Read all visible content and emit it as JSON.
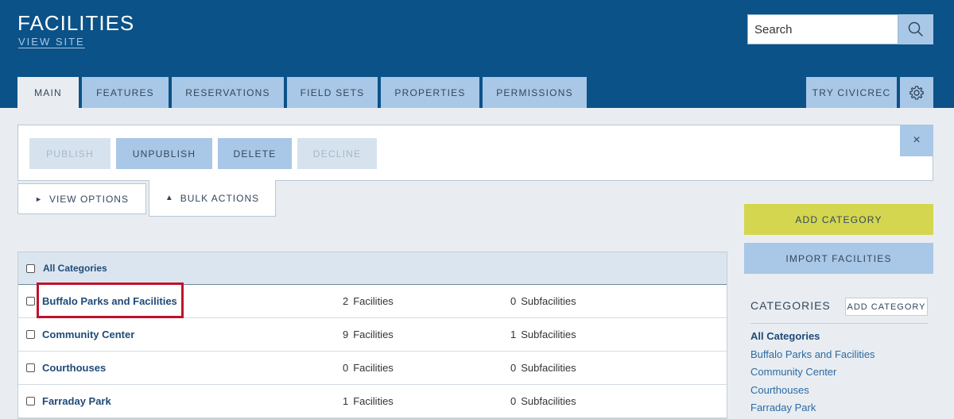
{
  "header": {
    "title": "FACILITIES",
    "view_site": "VIEW SITE",
    "search_placeholder": "Search",
    "tabs": [
      "MAIN",
      "FEATURES",
      "RESERVATIONS",
      "FIELD SETS",
      "PROPERTIES",
      "PERMISSIONS"
    ],
    "try_civicrec": "TRY CIVICREC"
  },
  "actions": {
    "publish": "PUBLISH",
    "unpublish": "UNPUBLISH",
    "delete": "DELETE",
    "decline": "DECLINE",
    "close": "×",
    "view_options": "VIEW OPTIONS",
    "bulk_actions": "BULK ACTIONS",
    "view_options_arrow": "►",
    "bulk_actions_arrow": "▲"
  },
  "table": {
    "header_label": "All Categories",
    "rows": [
      {
        "name": "Buffalo Parks and Facilities",
        "facilities": "2",
        "facilities_label": "Facilities",
        "subfacilities": "0",
        "subfacilities_label": "Subfacilities"
      },
      {
        "name": "Community Center",
        "facilities": "9",
        "facilities_label": "Facilities",
        "subfacilities": "1",
        "subfacilities_label": "Subfacilities"
      },
      {
        "name": "Courthouses",
        "facilities": "0",
        "facilities_label": "Facilities",
        "subfacilities": "0",
        "subfacilities_label": "Subfacilities"
      },
      {
        "name": "Farraday Park",
        "facilities": "1",
        "facilities_label": "Facilities",
        "subfacilities": "0",
        "subfacilities_label": "Subfacilities"
      }
    ]
  },
  "sidebar": {
    "add_category": "ADD CATEGORY",
    "import_facilities": "IMPORT FACILITIES",
    "categories_heading": "CATEGORIES",
    "add_category_small": "ADD CATEGORY",
    "categories": [
      "All Categories",
      "Buffalo Parks and Facilities",
      "Community Center",
      "Courthouses",
      "Farraday Park"
    ]
  },
  "colors": {
    "header_bg": "#0b5288",
    "tab_bg": "#a9c7e6",
    "add_category_bg": "#d4d64f",
    "highlight": "#c0122b"
  }
}
